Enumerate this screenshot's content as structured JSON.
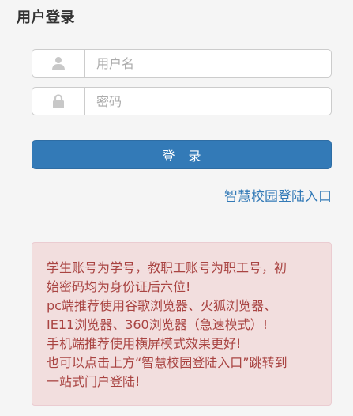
{
  "login": {
    "title": "用户登录",
    "username": {
      "placeholder": "用户名",
      "value": "",
      "icon": "user-icon"
    },
    "password": {
      "placeholder": "密码",
      "value": "",
      "icon": "lock-icon"
    },
    "submit_label": "登 录",
    "portal_link": "智慧校园登陆入口"
  },
  "notice": {
    "lines": [
      "学生账号为学号，教职工账号为职工号，初",
      "始密码均为身份证后六位!",
      "pc端推荐使用谷歌浏览器、火狐浏览器、",
      "IE11浏览器、360浏览器（急速模式）!",
      "手机端推荐使用横屏模式效果更好!",
      "也可以点击上方“智慧校园登陆入口”跳转到",
      "一站式门户登陆!"
    ]
  },
  "colors": {
    "primary": "#337ab7",
    "alert_bg": "#f2dede",
    "alert_text": "#a94442",
    "icon_gray": "#c8c8c8"
  }
}
